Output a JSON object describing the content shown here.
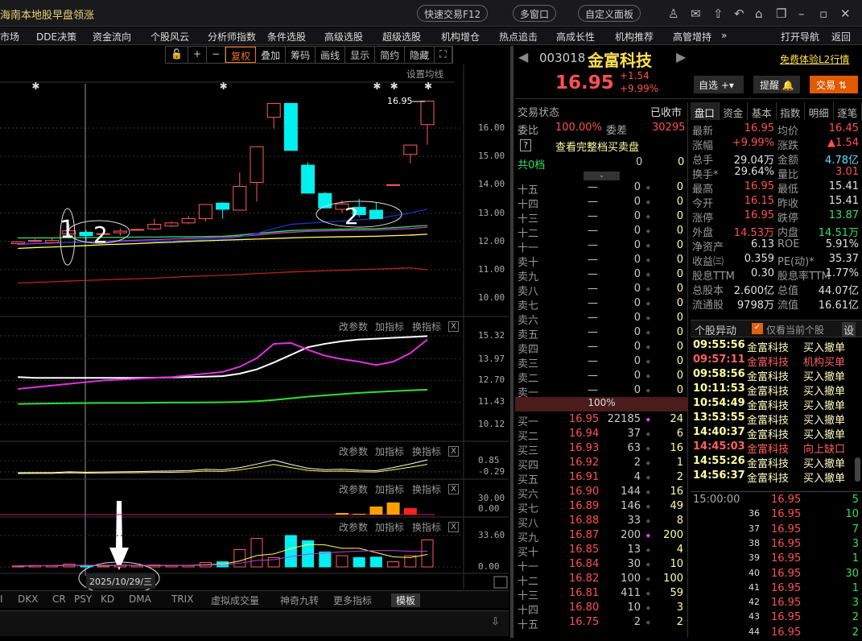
{
  "window": {
    "title": "海南本地股早盘领涨",
    "quick_trade": "快速交易F12",
    "multi_window": "多窗口",
    "custom_panel": "自定义面板"
  },
  "menu": [
    "市场",
    "DDE决策",
    "资金流向",
    "个股风云",
    "分析师指数",
    "条件选股",
    "高级选股",
    "超级选股",
    "机构增仓",
    "热点追击",
    "高成长性",
    "机构推荐",
    "高管增持",
    "»",
    "打开导航",
    "返回"
  ],
  "toolbar": [
    "+",
    "−",
    "复权",
    "叠加",
    "筹码",
    "画线",
    "显示",
    "简约",
    "隐藏"
  ],
  "chart": {
    "ma_setting": "设置均线",
    "last_price_label": "16.95",
    "y_ticks": [
      "16.00",
      "15.00",
      "14.00",
      "13.00",
      "12.00",
      "11.00",
      "10.00"
    ],
    "annotations": {
      "one": "1",
      "two_a": "2",
      "two_b": "2"
    },
    "candles": [
      [
        11.92,
        11.98,
        12.0,
        11.88
      ],
      [
        12.03,
        12.03,
        12.08,
        11.98
      ],
      [
        11.96,
        12.03,
        12.13,
        11.94
      ],
      [
        12.26,
        12.37,
        12.6,
        12.1
      ],
      [
        12.32,
        12.2,
        12.4,
        12.0
      ],
      [
        12.27,
        12.27,
        12.3,
        12.24
      ],
      [
        12.3,
        12.36,
        12.45,
        12.2
      ],
      [
        12.42,
        12.42,
        12.45,
        12.38
      ],
      [
        12.44,
        12.6,
        12.8,
        12.38
      ],
      [
        12.54,
        12.65,
        12.7,
        12.5
      ],
      [
        12.65,
        12.8,
        12.9,
        12.6
      ],
      [
        12.8,
        13.3,
        13.3,
        12.7
      ],
      [
        13.35,
        13.13,
        13.38,
        12.8
      ],
      [
        13.1,
        13.94,
        14.43,
        13.1
      ],
      [
        14.08,
        15.34,
        15.34,
        13.4
      ],
      [
        16.38,
        16.87,
        16.87,
        15.98
      ],
      [
        16.87,
        15.21,
        16.87,
        15.21
      ],
      [
        14.69,
        13.7,
        14.8,
        13.7
      ],
      [
        13.69,
        13.18,
        13.75,
        13.15
      ],
      [
        13.13,
        13.32,
        13.45,
        13.0
      ],
      [
        13.2,
        12.94,
        13.5,
        12.85
      ],
      [
        13.1,
        12.8,
        13.37,
        12.8
      ],
      [
        14.0,
        14.0,
        14.02,
        13.98
      ],
      [
        15.07,
        15.4,
        15.4,
        14.75
      ],
      [
        16.12,
        16.95,
        16.95,
        15.41
      ]
    ],
    "ma_lines": [
      {
        "color": "#ffff60",
        "values": [
          11.75,
          11.78,
          11.8,
          11.82,
          11.85,
          11.88,
          11.9,
          11.92,
          11.95,
          11.97,
          12.0,
          12.02,
          12.04,
          12.06,
          12.08,
          12.1,
          12.12,
          12.14,
          12.15,
          12.16,
          12.17,
          12.18,
          12.2,
          12.22,
          12.25
        ]
      },
      {
        "color": "#c040c0",
        "values": [
          11.9,
          11.92,
          11.94,
          11.96,
          11.98,
          12.0,
          12.02,
          12.04,
          12.06,
          12.08,
          12.1,
          12.12,
          12.14,
          12.18,
          12.22,
          12.28,
          12.32,
          12.35,
          12.37,
          12.38,
          12.39,
          12.4,
          12.42,
          12.45,
          12.5
        ]
      },
      {
        "color": "#30e060",
        "values": [
          12.12,
          12.12,
          12.12,
          12.13,
          12.13,
          12.14,
          12.14,
          12.15,
          12.15,
          12.16,
          12.16,
          12.17,
          12.18,
          12.22,
          12.28,
          12.33,
          12.38,
          12.4,
          12.42,
          12.43,
          12.44,
          12.45,
          12.48,
          12.52,
          12.56
        ]
      },
      {
        "color": "#2030c0",
        "values": [
          11.92,
          11.94,
          11.95,
          11.96,
          11.97,
          11.98,
          11.99,
          12.0,
          12.01,
          12.02,
          12.04,
          12.06,
          12.08,
          12.15,
          12.28,
          12.45,
          12.6,
          12.64,
          12.68,
          12.72,
          12.76,
          12.8,
          12.9,
          13.0,
          13.14
        ]
      },
      {
        "color": "#c02020",
        "values": [
          10.53,
          10.55,
          10.57,
          10.6,
          10.62,
          10.64,
          10.66,
          10.68,
          10.7,
          10.73,
          10.76,
          10.78,
          10.8,
          10.83,
          10.86,
          10.89,
          10.92,
          10.94,
          10.96,
          10.98,
          11.0,
          11.02,
          11.04,
          11.06,
          11.0
        ]
      }
    ],
    "star_marks": [
      1,
      12,
      21,
      22,
      24
    ]
  },
  "panels": {
    "ctl": {
      "params": "改参数",
      "add": "加指标",
      "switch": "换指标",
      "close": "X"
    },
    "p1": {
      "ticks": [
        "15.32",
        "13.97",
        "12.70",
        "11.43",
        "10.12"
      ],
      "white": [
        12.9,
        12.85,
        12.85,
        12.85,
        12.85,
        12.85,
        12.85,
        12.85,
        12.86,
        12.88,
        12.9,
        12.92,
        12.95,
        13.1,
        13.35,
        13.75,
        14.2,
        14.65,
        14.85,
        15.0,
        15.1,
        15.15,
        15.2,
        15.25,
        15.3
      ],
      "magenta": [
        12.2,
        12.3,
        12.4,
        12.5,
        12.6,
        12.7,
        12.75,
        12.8,
        12.85,
        12.9,
        13.0,
        13.1,
        13.2,
        13.5,
        14.0,
        14.85,
        14.9,
        14.5,
        14.15,
        13.95,
        13.8,
        13.6,
        13.8,
        14.3,
        15.1
      ],
      "green": [
        11.32,
        11.34,
        11.35,
        11.36,
        11.37,
        11.38,
        11.38,
        11.38,
        11.39,
        11.4,
        11.4,
        11.41,
        11.42,
        11.44,
        11.48,
        11.55,
        11.65,
        11.75,
        11.82,
        11.9,
        11.97,
        12.02,
        12.07,
        12.12,
        12.16
      ]
    },
    "p2": {
      "ticks": [
        "0.85",
        "-0.29"
      ]
    },
    "p3": {
      "ticks": [
        "30.00",
        "0.00"
      ],
      "bars": [
        0,
        0,
        0,
        0,
        0,
        0,
        0,
        0,
        0,
        0,
        0,
        0,
        0,
        0,
        0,
        0,
        0,
        0,
        0,
        2,
        1,
        10,
        15,
        8,
        0
      ]
    },
    "p4": {
      "ticks": [
        "33.60",
        "0.00"
      ],
      "volume": [
        1,
        1.5,
        1.5,
        3,
        1,
        1,
        2,
        1.5,
        2,
        1.5,
        1.5,
        4.8,
        5.5,
        18.5,
        30.5,
        10,
        33.6,
        28,
        16,
        12,
        10,
        10.5,
        5.5,
        12,
        29
      ]
    },
    "date_label": "2025/10/29/三"
  },
  "bottom_tabs": [
    "I",
    "DKX",
    "CR",
    "PSY",
    "KD",
    "DMA",
    "TRIX",
    "虚拟成交量",
    "神奇九转",
    "更多指标",
    "模板"
  ],
  "stock": {
    "code": "003018",
    "name": "金富科技",
    "l2": "免费体验L2行情",
    "price": "16.95",
    "change": "+1.54",
    "pct": "+9.99%",
    "watch": "自选",
    "alert": "提醒",
    "trade": "交易"
  },
  "orderbook": {
    "status_label": "交易状态",
    "status": "已收市",
    "wb_label": "委比",
    "wb": "100.00%",
    "wc_label": "委差",
    "wc": "30295",
    "full_link": "查看完整档买卖盘",
    "total": "共0档",
    "total_vol": "0",
    "total_cnt": "0",
    "pct_bar": "100%",
    "sells": [
      [
        "十五",
        "—",
        "0",
        "0"
      ],
      [
        "十四",
        "—",
        "0",
        "0"
      ],
      [
        "十三",
        "—",
        "0",
        "0"
      ],
      [
        "十二",
        "—",
        "0",
        "0"
      ],
      [
        "十一",
        "—",
        "0",
        "0"
      ],
      [
        "卖十",
        "—",
        "0",
        "0"
      ],
      [
        "卖九",
        "—",
        "0",
        "0"
      ],
      [
        "卖八",
        "—",
        "0",
        "0"
      ],
      [
        "卖七",
        "—",
        "0",
        "0"
      ],
      [
        "卖六",
        "—",
        "0",
        "0"
      ],
      [
        "卖五",
        "—",
        "0",
        "0"
      ],
      [
        "卖四",
        "—",
        "0",
        "0"
      ],
      [
        "卖三",
        "—",
        "0",
        "0"
      ],
      [
        "卖二",
        "—",
        "0",
        "0"
      ],
      [
        "卖一",
        "—",
        "0",
        "0"
      ]
    ],
    "buys": [
      [
        "买一",
        "16.95",
        "22185",
        "24"
      ],
      [
        "买二",
        "16.94",
        "37",
        "6"
      ],
      [
        "买三",
        "16.93",
        "63",
        "16"
      ],
      [
        "买四",
        "16.92",
        "2",
        "1"
      ],
      [
        "买五",
        "16.91",
        "4",
        "2"
      ],
      [
        "买六",
        "16.90",
        "144",
        "16"
      ],
      [
        "买七",
        "16.89",
        "146",
        "49"
      ],
      [
        "买八",
        "16.88",
        "33",
        "8"
      ],
      [
        "买九",
        "16.87",
        "200",
        "200"
      ],
      [
        "买十",
        "16.85",
        "13",
        "4"
      ],
      [
        "十一",
        "16.84",
        "30",
        "10"
      ],
      [
        "十二",
        "16.82",
        "100",
        "100"
      ],
      [
        "十三",
        "16.81",
        "411",
        "59"
      ],
      [
        "十四",
        "16.80",
        "10",
        "3"
      ],
      [
        "十五",
        "16.75",
        "2",
        "2"
      ]
    ]
  },
  "info_tabs": [
    "盘口",
    "资金",
    "基本",
    "指数",
    "明细",
    "逐笔"
  ],
  "quote": [
    [
      "最新",
      "16.95",
      "red",
      "均价",
      "16.45",
      "red"
    ],
    [
      "涨幅",
      "+9.99%",
      "red",
      "涨跌",
      "▲1.54",
      "red"
    ],
    [
      "总手",
      "29.04万",
      "wht",
      "金额",
      "4.78亿",
      "cyan"
    ],
    [
      "换手*",
      "29.64%",
      "wht",
      "量比",
      "3.01",
      "red"
    ],
    [
      "最高",
      "16.95",
      "red",
      "最低",
      "15.41",
      "wht"
    ],
    [
      "今开",
      "16.15",
      "red",
      "昨收",
      "15.41",
      "wht"
    ],
    [
      "涨停",
      "16.95",
      "red",
      "跌停",
      "13.87",
      "grn"
    ],
    [
      "外盘",
      "14.53万",
      "red",
      "内盘",
      "14.51万",
      "grn"
    ],
    [
      "净资产",
      "6.13",
      "wht",
      "ROE",
      "5.91%",
      "wht"
    ],
    [
      "收益㈢",
      "0.359",
      "wht",
      "PE(动)*",
      "35.37",
      "wht"
    ],
    [
      "股息TTM",
      "0.30",
      "wht",
      "股息率TTM",
      "1.77%",
      "wht"
    ],
    [
      "总股本",
      "2.600亿",
      "wht",
      "总值",
      "44.07亿",
      "wht"
    ],
    [
      "流通股",
      "9798万",
      "wht",
      "流值",
      "16.61亿",
      "wht"
    ]
  ],
  "events": {
    "title": "个股异动",
    "filter": "仅看当前个股",
    "settings": "设",
    "items": [
      [
        "09:55:56",
        "金富科技",
        "买入撤单",
        false
      ],
      [
        "09:57:11",
        "金富科技",
        "机构买单",
        true
      ],
      [
        "09:58:56",
        "金富科技",
        "买入撤单",
        false
      ],
      [
        "10:11:53",
        "金富科技",
        "买入撤单",
        false
      ],
      [
        "10:54:49",
        "金富科技",
        "买入撤单",
        false
      ],
      [
        "13:53:55",
        "金富科技",
        "买入撤单",
        false
      ],
      [
        "14:40:37",
        "金富科技",
        "买入撤单",
        false
      ],
      [
        "14:45:03",
        "金富科技",
        "向上缺口",
        true
      ],
      [
        "14:55:26",
        "金富科技",
        "买入撤单",
        false
      ],
      [
        "14:56:37",
        "金富科技",
        "买入撤单",
        false
      ]
    ]
  },
  "ticks": [
    [
      "15:00:00",
      "16.95",
      "5"
    ],
    [
      "36",
      "16.95",
      "10"
    ],
    [
      "37",
      "16.95",
      "7"
    ],
    [
      "38",
      "16.95",
      "3"
    ],
    [
      "39",
      "16.95",
      "1"
    ],
    [
      "40",
      "16.95",
      "30"
    ],
    [
      "41",
      "16.95",
      "1"
    ],
    [
      "42",
      "16.95",
      "3"
    ],
    [
      "43",
      "16.95",
      "2"
    ],
    [
      "44",
      "16.95",
      "2"
    ]
  ]
}
